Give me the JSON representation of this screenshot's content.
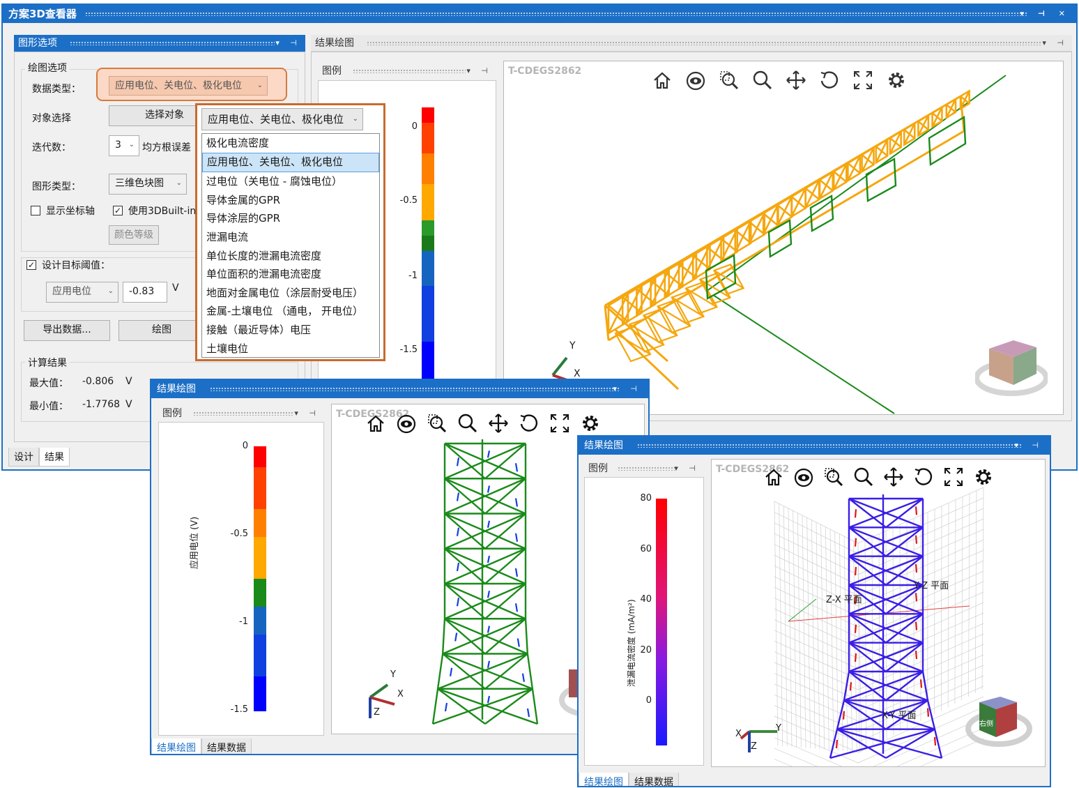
{
  "main_window": {
    "title": "方案3D查看器",
    "options_panel": {
      "header": "图形选项",
      "group_plot": "绘图选项",
      "data_type_label": "数据类型：",
      "data_type_value": "应用电位、关电位、极化电位",
      "object_select_label": "对象选择",
      "object_select_button": "选择对象",
      "iterations_label": "迭代数：",
      "iterations_value": "3",
      "rms_label": "均方根误差",
      "graph_type_label": "图形类型：",
      "graph_type_value": "三维色块图",
      "show_axes_label": "显示坐标轴",
      "show_axes_checked": false,
      "use_3d_label": "使用3DBuilt-in",
      "use_3d_checked": true,
      "color_levels_button": "颜色等级",
      "design_target_label": "设计目标阈值：",
      "design_target_checked": true,
      "threshold_type": "应用电位",
      "threshold_value": "-0.83",
      "threshold_unit": "V",
      "export_button": "导出数据...",
      "plot_button": "绘图",
      "group_results": "计算结果",
      "max_label": "最大值：",
      "max_value": "-0.806",
      "max_unit": "V",
      "min_label": "最小值：",
      "min_value": "-1.7768",
      "min_unit": "V"
    },
    "bottom_tabs": [
      "设计",
      "结果"
    ],
    "result_panel": {
      "header": "结果绘图",
      "legend_header": "图例",
      "view_title": "T-CDEGS2862",
      "legend_ticks": [
        "0",
        "-0.5",
        "-1",
        "-1.5"
      ],
      "axis_labels": [
        "Y",
        "X"
      ]
    }
  },
  "dropdown": {
    "current": "应用电位、关电位、极化电位",
    "items": [
      "极化电流密度",
      "应用电位、关电位、极化电位",
      "过电位（关电位 - 腐蚀电位）",
      "导体金属的GPR",
      "导体涂层的GPR",
      "泄漏电流",
      "单位长度的泄漏电流密度",
      "单位面积的泄漏电流密度",
      "地面对金属电位（涂层耐受电压）",
      "金属-土壤电位 （通电， 开电位）",
      "接触（最近导体）电压",
      "土壤电位"
    ],
    "selected_index": 1
  },
  "toolbar_icons": [
    "home-icon",
    "eye-icon",
    "zoom-box-icon",
    "zoom-icon",
    "pan-icon",
    "rotate-icon",
    "fit-icon",
    "settings-icon"
  ],
  "window2": {
    "title": "结果绘图",
    "legend_header": "图例",
    "view_title": "T-CDEGS2862",
    "legend_ticks": [
      "0",
      "-0.5",
      "-1",
      "-1.5"
    ],
    "legend_axis_label": "应用电位 (V)",
    "axis_labels": [
      "Y",
      "X",
      "Z"
    ],
    "tabs": [
      "结果绘图",
      "结果数据"
    ]
  },
  "window3": {
    "title": "结果绘图",
    "legend_header": "图例",
    "view_title": "T-CDEGS2862",
    "legend_ticks": [
      "80",
      "60",
      "40",
      "20",
      "0"
    ],
    "legend_axis_label": "泄漏电流密度 (mA/m²)",
    "plane_labels": [
      "Z-X 平面",
      "Y-Z 平面",
      "X-Y 平面"
    ],
    "axis_labels": [
      "Y",
      "X",
      "Z"
    ],
    "cube_label": "右侧",
    "tabs": [
      "结果绘图",
      "结果数据"
    ]
  },
  "colors": {
    "accent": "#1c6fc6",
    "highlight_orange": "#e07a35",
    "mesh_orange": "#f5a70f",
    "mesh_green": "#1a8a1a",
    "tower_blue": "#3a1ee6"
  }
}
